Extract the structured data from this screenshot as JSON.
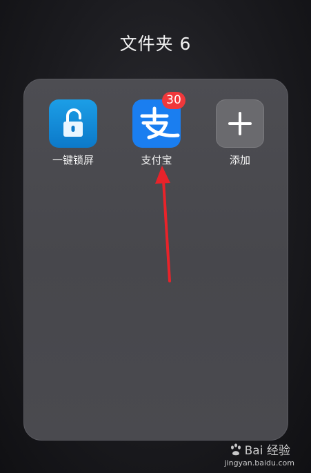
{
  "folder": {
    "title": "文件夹 6"
  },
  "apps": [
    {
      "label": "一键锁屏",
      "icon": "lock-icon",
      "color": "#1589d9"
    },
    {
      "label": "支付宝",
      "icon": "alipay-logo-icon",
      "color": "#1a7ef0",
      "badge": "30"
    },
    {
      "label": "添加",
      "icon": "plus-icon",
      "color": "#6a6a6e"
    }
  ],
  "annotation": {
    "arrow_color": "#e8232a"
  },
  "watermark": {
    "brand": "Bai 经验",
    "url": "jingyan.baidu.com"
  }
}
